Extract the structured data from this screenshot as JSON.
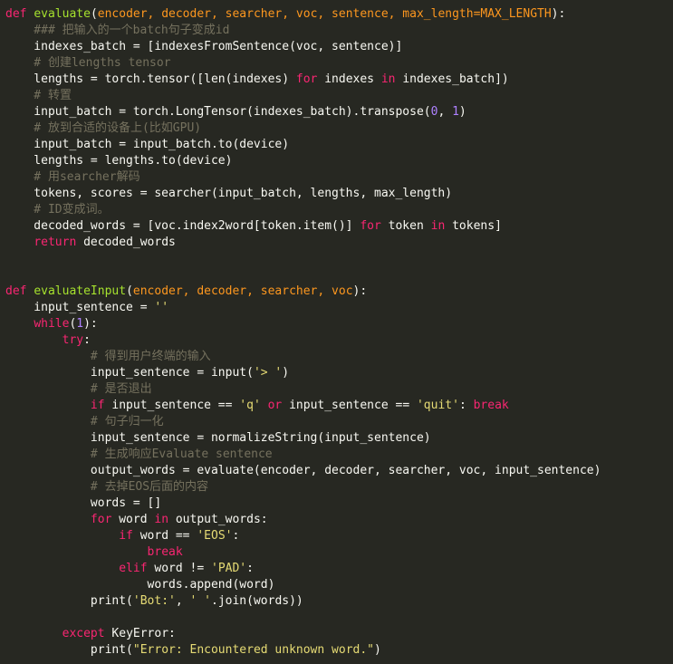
{
  "colors": {
    "background": "#272822",
    "keyword": "#f92672",
    "function": "#a6e22e",
    "parameter": "#fd971f",
    "string": "#e6db74",
    "number": "#ae81ff",
    "comment": "#75715e",
    "plain": "#f8f8f2"
  },
  "code_lines": [
    [
      [
        "kw",
        "def"
      ],
      [
        "pl",
        " "
      ],
      [
        "fn",
        "evaluate"
      ],
      [
        "pl",
        "("
      ],
      [
        "param",
        "encoder, decoder, searcher, voc, sentence, max_length=MAX_LENGTH"
      ],
      [
        "pl",
        "):"
      ]
    ],
    [
      [
        "cm",
        "    ### 把输入的一个batch句子变成id"
      ]
    ],
    [
      [
        "pl",
        "    indexes_batch = [indexesFromSentence(voc, sentence)]"
      ]
    ],
    [
      [
        "cm",
        "    # 创建lengths tensor"
      ]
    ],
    [
      [
        "pl",
        "    lengths = torch.tensor([len(indexes) "
      ],
      [
        "kw",
        "for"
      ],
      [
        "pl",
        " indexes "
      ],
      [
        "kw",
        "in"
      ],
      [
        "pl",
        " indexes_batch])"
      ]
    ],
    [
      [
        "cm",
        "    # 转置"
      ]
    ],
    [
      [
        "pl",
        "    input_batch = torch.LongTensor(indexes_batch).transpose("
      ],
      [
        "num",
        "0"
      ],
      [
        "pl",
        ", "
      ],
      [
        "num",
        "1"
      ],
      [
        "pl",
        ")"
      ]
    ],
    [
      [
        "cm",
        "    # 放到合适的设备上(比如GPU)"
      ]
    ],
    [
      [
        "pl",
        "    input_batch = input_batch.to(device)"
      ]
    ],
    [
      [
        "pl",
        "    lengths = lengths.to(device)"
      ]
    ],
    [
      [
        "cm",
        "    # 用searcher解码"
      ]
    ],
    [
      [
        "pl",
        "    tokens, scores = searcher(input_batch, lengths, max_length)"
      ]
    ],
    [
      [
        "cm",
        "    # ID变成词。"
      ]
    ],
    [
      [
        "pl",
        "    decoded_words = [voc.index2word[token.item()] "
      ],
      [
        "kw",
        "for"
      ],
      [
        "pl",
        " token "
      ],
      [
        "kw",
        "in"
      ],
      [
        "pl",
        " tokens]"
      ]
    ],
    [
      [
        "pl",
        "    "
      ],
      [
        "kw",
        "return"
      ],
      [
        "pl",
        " decoded_words"
      ]
    ],
    [],
    [],
    [
      [
        "kw",
        "def"
      ],
      [
        "pl",
        " "
      ],
      [
        "fn",
        "evaluateInput"
      ],
      [
        "pl",
        "("
      ],
      [
        "param",
        "encoder, decoder, searcher, voc"
      ],
      [
        "pl",
        "):"
      ]
    ],
    [
      [
        "pl",
        "    input_sentence = "
      ],
      [
        "str",
        "''"
      ]
    ],
    [
      [
        "pl",
        "    "
      ],
      [
        "kw",
        "while"
      ],
      [
        "pl",
        "("
      ],
      [
        "num",
        "1"
      ],
      [
        "pl",
        "):"
      ]
    ],
    [
      [
        "pl",
        "        "
      ],
      [
        "kw",
        "try"
      ],
      [
        "pl",
        ":"
      ]
    ],
    [
      [
        "cm",
        "            # 得到用户终端的输入"
      ]
    ],
    [
      [
        "pl",
        "            input_sentence = input("
      ],
      [
        "str",
        "'> '"
      ],
      [
        "pl",
        ")"
      ]
    ],
    [
      [
        "cm",
        "            # 是否退出"
      ]
    ],
    [
      [
        "pl",
        "            "
      ],
      [
        "kw",
        "if"
      ],
      [
        "pl",
        " input_sentence == "
      ],
      [
        "str",
        "'q'"
      ],
      [
        "pl",
        " "
      ],
      [
        "kw",
        "or"
      ],
      [
        "pl",
        " input_sentence == "
      ],
      [
        "str",
        "'quit'"
      ],
      [
        "pl",
        ": "
      ],
      [
        "kw",
        "break"
      ]
    ],
    [
      [
        "cm",
        "            # 句子归一化"
      ]
    ],
    [
      [
        "pl",
        "            input_sentence = normalizeString(input_sentence)"
      ]
    ],
    [
      [
        "cm",
        "            # 生成响应Evaluate sentence"
      ]
    ],
    [
      [
        "pl",
        "            output_words = evaluate(encoder, decoder, searcher, voc, input_sentence)"
      ]
    ],
    [
      [
        "cm",
        "            # 去掉EOS后面的内容"
      ]
    ],
    [
      [
        "pl",
        "            words = []"
      ]
    ],
    [
      [
        "pl",
        "            "
      ],
      [
        "kw",
        "for"
      ],
      [
        "pl",
        " word "
      ],
      [
        "kw",
        "in"
      ],
      [
        "pl",
        " output_words:"
      ]
    ],
    [
      [
        "pl",
        "                "
      ],
      [
        "kw",
        "if"
      ],
      [
        "pl",
        " word == "
      ],
      [
        "str",
        "'EOS'"
      ],
      [
        "pl",
        ":"
      ]
    ],
    [
      [
        "pl",
        "                    "
      ],
      [
        "kw",
        "break"
      ]
    ],
    [
      [
        "pl",
        "                "
      ],
      [
        "kw",
        "elif"
      ],
      [
        "pl",
        " word != "
      ],
      [
        "str",
        "'PAD'"
      ],
      [
        "pl",
        ":"
      ]
    ],
    [
      [
        "pl",
        "                    words.append(word)"
      ]
    ],
    [
      [
        "pl",
        "            print("
      ],
      [
        "str",
        "'Bot:'"
      ],
      [
        "pl",
        ", "
      ],
      [
        "str",
        "' '"
      ],
      [
        "pl",
        ".join(words))"
      ]
    ],
    [],
    [
      [
        "pl",
        "        "
      ],
      [
        "kw",
        "except"
      ],
      [
        "pl",
        " KeyError:"
      ]
    ],
    [
      [
        "pl",
        "            print("
      ],
      [
        "str",
        "\"Error: Encountered unknown word.\""
      ],
      [
        "pl",
        ")"
      ]
    ]
  ]
}
